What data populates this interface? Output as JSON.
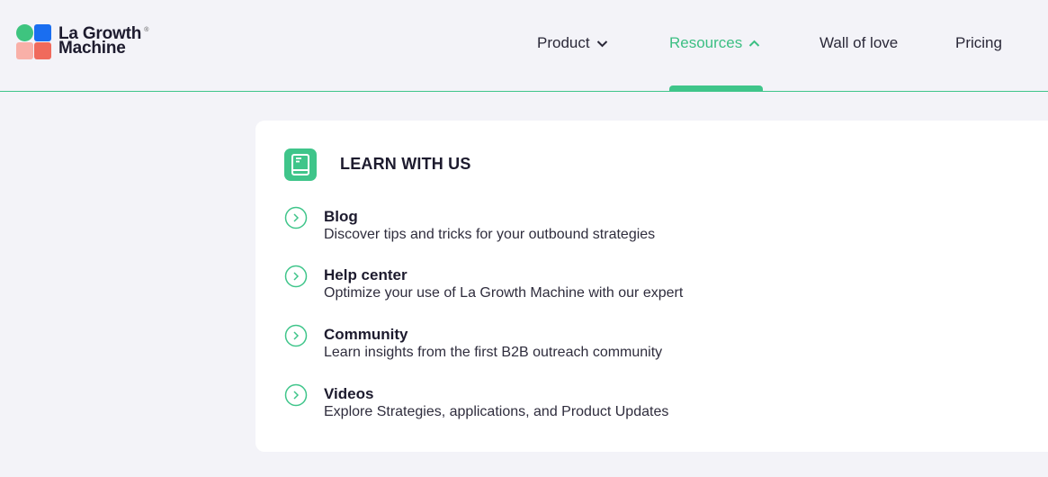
{
  "brand": {
    "name_line1": "La Growth",
    "name_line2": "Machine",
    "registered_mark": "®",
    "colors": {
      "green": "#3ec47f",
      "blue": "#1a6ef0",
      "red": "#f06a5c",
      "pink": "#f9b0a8"
    }
  },
  "nav": {
    "items": [
      {
        "label": "Product",
        "icon": "chevron-down-icon"
      },
      {
        "label": "Resources",
        "icon": "chevron-up-icon",
        "active": true
      },
      {
        "label": "Wall of love"
      },
      {
        "label": "Pricing"
      }
    ]
  },
  "menu": {
    "section_title": "LEARN WITH US",
    "section_icon": "book-icon",
    "items": [
      {
        "title": "Blog",
        "description": "Discover tips and tricks for your outbound strategies",
        "icon": "chevron-circle-icon"
      },
      {
        "title": "Help center",
        "description": "Optimize your use of La Growth Machine with our expert",
        "icon": "chevron-circle-icon"
      },
      {
        "title": "Community",
        "description": "Learn insights from the first B2B outreach community",
        "icon": "chevron-circle-icon"
      },
      {
        "title": "Videos",
        "description": "Explore Strategies, applications, and Product Updates",
        "icon": "chevron-circle-icon"
      }
    ]
  },
  "colors": {
    "accent": "#3fc58a",
    "background": "#f3f3f8",
    "panel": "#ffffff",
    "text": "#1d1b2e"
  }
}
